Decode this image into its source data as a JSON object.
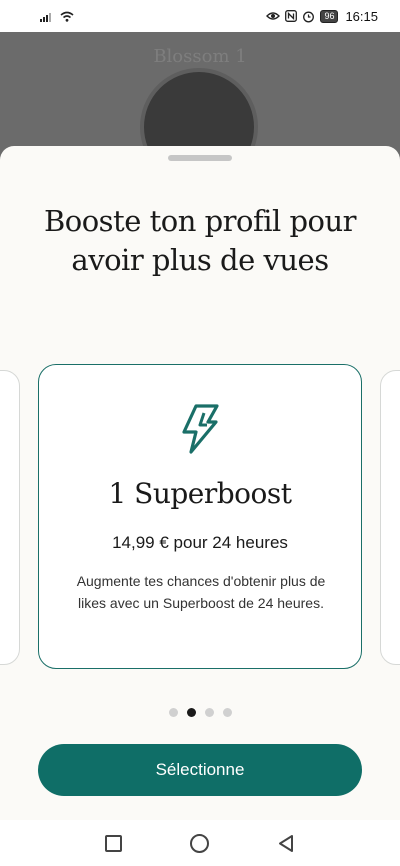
{
  "status_bar": {
    "time": "16:15",
    "battery": "96",
    "left_icons": [
      "signal-icon",
      "wifi-icon"
    ],
    "right_icons": [
      "eye-icon",
      "nfc-icon",
      "alarm-icon",
      "battery-icon"
    ]
  },
  "background": {
    "title_partial": "Blossom 1"
  },
  "sheet": {
    "headline": "Booste ton profil pour avoir plus de vues",
    "card": {
      "icon": "lightning-bolt-icon",
      "title": "1 Superboost",
      "price": "14,99 € pour 24 heures",
      "description": "Augmente tes chances d'obtenir plus de likes avec un Superboost de 24 heures."
    },
    "pagination": {
      "count": 4,
      "active_index": 1
    },
    "cta_label": "Sélectionne"
  },
  "colors": {
    "accent": "#0f6e67",
    "sheet_bg": "#fbfaf7",
    "dim_overlay": "#6b6b6b"
  },
  "nav_bar": {
    "buttons": [
      "recents-square-icon",
      "home-circle-icon",
      "back-triangle-icon"
    ]
  }
}
